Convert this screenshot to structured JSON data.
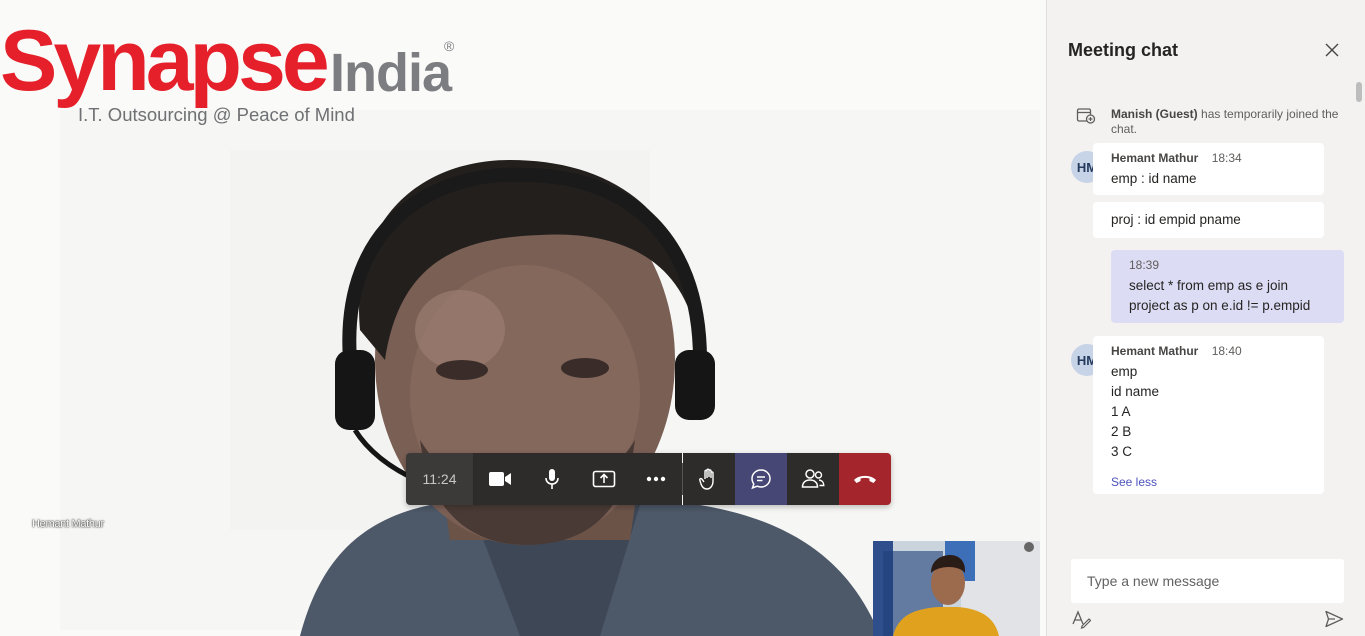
{
  "logo": {
    "brand_red": "Synapse",
    "brand_grey": "India",
    "registered": "®",
    "tagline": "I.T. Outsourcing @ Peace of Mind"
  },
  "video": {
    "participant_name": "Hemant Mathur"
  },
  "controls": {
    "timer": "11:24",
    "buttons": [
      {
        "name": "camera",
        "icon": "video-camera-icon"
      },
      {
        "name": "mic",
        "icon": "microphone-icon"
      },
      {
        "name": "share",
        "icon": "share-screen-icon"
      },
      {
        "name": "more",
        "icon": "more-options-icon"
      },
      {
        "name": "raise-hand",
        "icon": "raise-hand-icon"
      },
      {
        "name": "chat",
        "icon": "chat-icon"
      },
      {
        "name": "participants",
        "icon": "people-icon"
      },
      {
        "name": "hang-up",
        "icon": "hang-up-icon"
      }
    ],
    "colors": {
      "bar": "#2d2c2b",
      "active": "#464775",
      "hangup": "#a4262c"
    }
  },
  "chat": {
    "title": "Meeting chat",
    "system_message": {
      "name": "Manish (Guest)",
      "text": "has temporarily joined the chat."
    },
    "messages": [
      {
        "avatar": "HM",
        "author": "Hemant Mathur",
        "time": "18:34",
        "lines": [
          "emp : id name"
        ]
      },
      {
        "lines": [
          "proj : id empid pname"
        ]
      },
      {
        "time": "18:39",
        "lines": [
          "select * from emp as e join",
          "project as p on e.id != p.empid"
        ],
        "mine": true
      },
      {
        "avatar": "HM",
        "author": "Hemant Mathur",
        "time": "18:40",
        "lines": [
          "emp",
          "id name",
          "1 A",
          "2 B",
          "3 C"
        ],
        "see_less": "See less"
      }
    ],
    "compose_placeholder": "Type a new message",
    "colors": {
      "panel": "#f3f2f1",
      "mine_bubble": "#dcdcf4",
      "link": "#4b53bc"
    }
  }
}
